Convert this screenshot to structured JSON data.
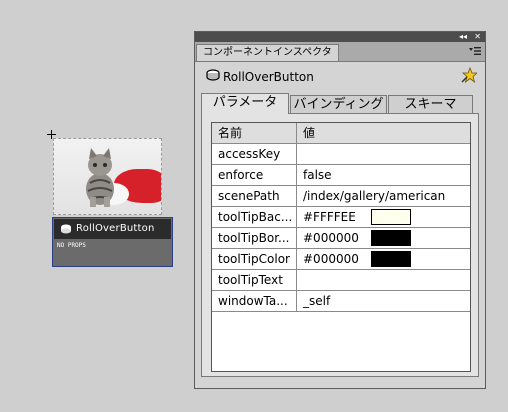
{
  "stage": {
    "rollover": {
      "label": "RollOverButton",
      "sub_label": "NO PROPS"
    }
  },
  "panel": {
    "title": "コンポーネントインスペクタ",
    "window_controls": [
      "◂◂",
      "✕"
    ],
    "component_name": "RollOverButton",
    "tabs": [
      {
        "label": "パラメータ",
        "active": true
      },
      {
        "label": "バインディング",
        "active": false
      },
      {
        "label": "スキーマ",
        "active": false
      }
    ],
    "grid": {
      "header": {
        "name": "名前",
        "value": "値"
      },
      "rows": [
        {
          "name": "accessKey",
          "value": ""
        },
        {
          "name": "enforce",
          "value": "false"
        },
        {
          "name": "scenePath",
          "value": "/index/gallery/american"
        },
        {
          "name": "toolTipBac...",
          "value": "#FFFFEE",
          "swatch": "#FFFFEE"
        },
        {
          "name": "toolTipBor...",
          "value": "#000000",
          "swatch": "#000000"
        },
        {
          "name": "toolTipColor",
          "value": "#000000",
          "swatch": "#000000"
        },
        {
          "name": "toolTipText",
          "value": ""
        },
        {
          "name": "windowTa...",
          "value": "_self"
        }
      ]
    }
  },
  "colors": {
    "background": "#cfcfcf",
    "panel": "#d4d4d4",
    "selection_border": "#2a3f8a"
  }
}
